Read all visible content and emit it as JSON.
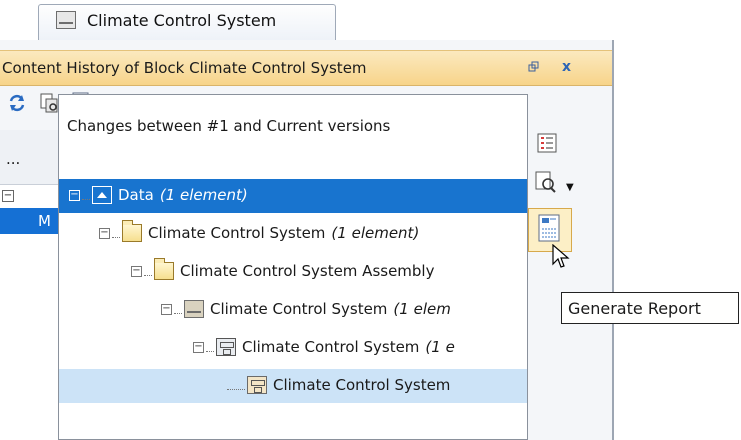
{
  "tab": {
    "title": "Climate Control System",
    "icon": "block-icon"
  },
  "panel": {
    "title": "Content History of Block Climate Control System",
    "restore_icon": "restore-icon",
    "close_label": "x"
  },
  "toolbar": {
    "buttons": [
      "refresh-icon",
      "compare-icon",
      "generate-report-icon"
    ]
  },
  "left_strip": {
    "column_header": "...",
    "row_label": "M"
  },
  "dialog": {
    "heading": "Changes between #1 and Current versions",
    "tree": [
      {
        "label": "Data",
        "note": "(1 element)",
        "icon": "data-package-icon",
        "state": "selected"
      },
      {
        "label": "Climate Control System",
        "note": "(1 element)",
        "icon": "package-icon"
      },
      {
        "label": "Climate Control System Assembly",
        "note": "",
        "icon": "package-icon"
      },
      {
        "label": "Climate Control System",
        "note": "(1 elem",
        "icon": "block-icon"
      },
      {
        "label": "Climate Control System",
        "note": "(1 e",
        "icon": "part-icon"
      },
      {
        "label": "Climate Control System",
        "note": "",
        "icon": "part-property-icon",
        "state": "highlighted"
      }
    ]
  },
  "side_buttons": [
    "list-icon",
    "view-icon",
    "generate-report-icon"
  ],
  "tooltip": {
    "text": "Generate Report"
  }
}
